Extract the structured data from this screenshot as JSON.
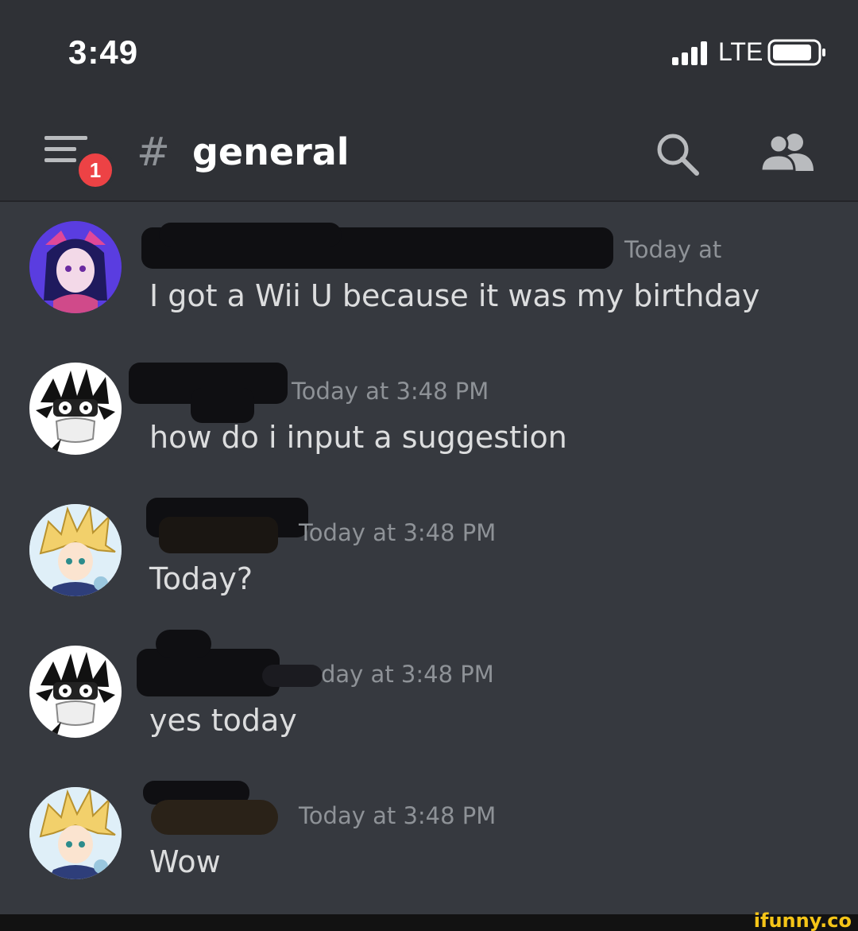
{
  "status_bar": {
    "time": "3:49",
    "network": "LTE",
    "icons": [
      "signal-icon",
      "battery-icon"
    ]
  },
  "header": {
    "menu_icon": "hamburger-menu-icon",
    "notification_count": "1",
    "channel_prefix": "#",
    "channel_name": "general",
    "icons": [
      "search-icon",
      "members-icon"
    ],
    "badge_color": "#ed4245"
  },
  "messages": [
    {
      "avatar": "purple-anime-avatar",
      "timestamp": "Today at",
      "text": "I got a Wii U because it was my birthday"
    },
    {
      "avatar": "black-white-masked-avatar",
      "timestamp": "Today at 3:48 PM",
      "text": "how do i input a suggestion"
    },
    {
      "avatar": "blonde-spiky-hair-avatar",
      "timestamp": "Today at 3:48 PM",
      "text": "Today?"
    },
    {
      "avatar": "black-white-masked-avatar",
      "timestamp": "day at 3:48 PM",
      "text": "yes today"
    },
    {
      "avatar": "blonde-spiky-hair-avatar",
      "timestamp": "Today at 3:48 PM",
      "text": "Wow"
    }
  ],
  "watermark": "ifunny.co",
  "colors": {
    "background": "#36393f",
    "header": "#2f3136",
    "text": "#dcddde",
    "muted": "#8e9297"
  }
}
